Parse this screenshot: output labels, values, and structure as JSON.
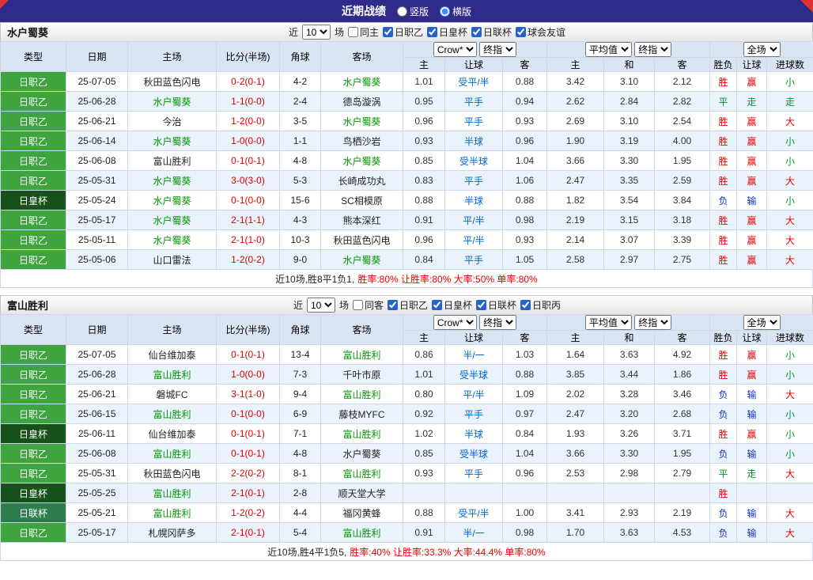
{
  "topbar": {
    "title": "近期战绩",
    "options": [
      {
        "label": "竖版",
        "selected": false
      },
      {
        "label": "横版",
        "selected": true
      }
    ]
  },
  "filter_labels": {
    "near": "近",
    "games": "场"
  },
  "columns": {
    "type": "类型",
    "date": "日期",
    "home": "主场",
    "score": "比分(半场)",
    "corner": "角球",
    "away": "客场",
    "crow": "Crow*",
    "final": "终指",
    "average": "平均值",
    "full": "全场",
    "sub": [
      "主",
      "让球",
      "客",
      "主",
      "和",
      "客",
      "胜负",
      "让球",
      "进球数"
    ]
  },
  "colors": {
    "topbar": "#2e2b8b",
    "league_j2": "#3fa33f",
    "league_emperor_cup": "#17521a",
    "league_league_cup": "#2e7d4f",
    "win": "#e60000",
    "draw": "#009933",
    "lose": "#1133cc",
    "score_text": "#e00000",
    "focus_team": "#009900",
    "handicap_text": "#0066cc"
  },
  "sections": [
    {
      "team": "水户蜀葵",
      "filter": {
        "count": "10",
        "same": "同主",
        "same_checked": false,
        "leagues": [
          {
            "label": "日职乙",
            "checked": true
          },
          {
            "label": "日皇杯",
            "checked": true
          },
          {
            "label": "日联杯",
            "checked": true
          },
          {
            "label": "球会友谊",
            "checked": true
          }
        ]
      },
      "rows": [
        {
          "league": "日职乙",
          "lc": "j2",
          "date": "25-07-05",
          "home": "秋田蓝色闪电",
          "hf": false,
          "score": "0-2(0-1)",
          "corner": "4-2",
          "away": "水户蜀葵",
          "af": true,
          "h": "1.01",
          "hcp": "受平/半",
          "a": "0.88",
          "m1": "3.42",
          "m2": "3.10",
          "m3": "2.12",
          "r": "胜",
          "c": "赢",
          "g": "小"
        },
        {
          "league": "日职乙",
          "lc": "j2",
          "date": "25-06-28",
          "home": "水户蜀葵",
          "hf": true,
          "score": "1-1(0-0)",
          "corner": "2-4",
          "away": "德岛漩涡",
          "af": false,
          "h": "0.95",
          "hcp": "平手",
          "a": "0.94",
          "m1": "2.62",
          "m2": "2.84",
          "m3": "2.82",
          "r": "平",
          "c": "走",
          "g": "走"
        },
        {
          "league": "日职乙",
          "lc": "j2",
          "date": "25-06-21",
          "home": "今治",
          "hf": false,
          "score": "1-2(0-0)",
          "corner": "3-5",
          "away": "水户蜀葵",
          "af": true,
          "h": "0.96",
          "hcp": "平手",
          "a": "0.93",
          "m1": "2.69",
          "m2": "3.10",
          "m3": "2.54",
          "r": "胜",
          "c": "赢",
          "g": "大"
        },
        {
          "league": "日职乙",
          "lc": "j2",
          "date": "25-06-14",
          "home": "水户蜀葵",
          "hf": true,
          "score": "1-0(0-0)",
          "corner": "1-1",
          "away": "鸟栖沙岩",
          "af": false,
          "h": "0.93",
          "hcp": "半球",
          "a": "0.96",
          "m1": "1.90",
          "m2": "3.19",
          "m3": "4.00",
          "r": "胜",
          "c": "赢",
          "g": "小"
        },
        {
          "league": "日职乙",
          "lc": "j2",
          "date": "25-06-08",
          "home": "富山胜利",
          "hf": false,
          "score": "0-1(0-1)",
          "corner": "4-8",
          "away": "水户蜀葵",
          "af": true,
          "h": "0.85",
          "hcp": "受半球",
          "a": "1.04",
          "m1": "3.66",
          "m2": "3.30",
          "m3": "1.95",
          "r": "胜",
          "c": "赢",
          "g": "小"
        },
        {
          "league": "日职乙",
          "lc": "j2",
          "date": "25-05-31",
          "home": "水户蜀葵",
          "hf": true,
          "score": "3-0(3-0)",
          "corner": "5-3",
          "away": "长崎成功丸",
          "af": false,
          "h": "0.83",
          "hcp": "平手",
          "a": "1.06",
          "m1": "2.47",
          "m2": "3.35",
          "m3": "2.59",
          "r": "胜",
          "c": "赢",
          "g": "大"
        },
        {
          "league": "日皇杯",
          "lc": "cup",
          "date": "25-05-24",
          "home": "水户蜀葵",
          "hf": true,
          "score": "0-1(0-0)",
          "corner": "15-6",
          "away": "SC相模原",
          "af": false,
          "h": "0.88",
          "hcp": "半球",
          "a": "0.88",
          "m1": "1.82",
          "m2": "3.54",
          "m3": "3.84",
          "r": "负",
          "c": "输",
          "g": "小"
        },
        {
          "league": "日职乙",
          "lc": "j2",
          "date": "25-05-17",
          "home": "水户蜀葵",
          "hf": true,
          "score": "2-1(1-1)",
          "corner": "4-3",
          "away": "熊本深红",
          "af": false,
          "h": "0.91",
          "hcp": "平/半",
          "a": "0.98",
          "m1": "2.19",
          "m2": "3.15",
          "m3": "3.18",
          "r": "胜",
          "c": "赢",
          "g": "大"
        },
        {
          "league": "日职乙",
          "lc": "j2",
          "date": "25-05-11",
          "home": "水户蜀葵",
          "hf": true,
          "score": "2-1(1-0)",
          "corner": "10-3",
          "away": "秋田蓝色闪电",
          "af": false,
          "h": "0.96",
          "hcp": "平/半",
          "a": "0.93",
          "m1": "2.14",
          "m2": "3.07",
          "m3": "3.39",
          "r": "胜",
          "c": "赢",
          "g": "大"
        },
        {
          "league": "日职乙",
          "lc": "j2",
          "date": "25-05-06",
          "home": "山口雷法",
          "hf": false,
          "score": "1-2(0-2)",
          "corner": "9-0",
          "away": "水户蜀葵",
          "af": true,
          "h": "0.84",
          "hcp": "平手",
          "a": "1.05",
          "m1": "2.58",
          "m2": "2.97",
          "m3": "2.75",
          "r": "胜",
          "c": "赢",
          "g": "大"
        }
      ],
      "footer": {
        "prefix": "近10场,胜8平1负1,",
        "stats": "胜率:80% 让胜率:80% 大率:50% 单率:80%"
      }
    },
    {
      "team": "富山胜利",
      "filter": {
        "count": "10",
        "same": "同客",
        "same_checked": false,
        "leagues": [
          {
            "label": "日职乙",
            "checked": true
          },
          {
            "label": "日皇杯",
            "checked": true
          },
          {
            "label": "日联杯",
            "checked": true
          },
          {
            "label": "日职丙",
            "checked": true
          }
        ]
      },
      "rows": [
        {
          "league": "日职乙",
          "lc": "j2",
          "date": "25-07-05",
          "home": "仙台维加泰",
          "hf": false,
          "score": "0-1(0-1)",
          "corner": "13-4",
          "away": "富山胜利",
          "af": true,
          "h": "0.86",
          "hcp": "半/一",
          "a": "1.03",
          "m1": "1.64",
          "m2": "3.63",
          "m3": "4.92",
          "r": "胜",
          "c": "赢",
          "g": "小"
        },
        {
          "league": "日职乙",
          "lc": "j2",
          "date": "25-06-28",
          "home": "富山胜利",
          "hf": true,
          "score": "1-0(0-0)",
          "corner": "7-3",
          "away": "千叶市原",
          "af": false,
          "h": "1.01",
          "hcp": "受半球",
          "a": "0.88",
          "m1": "3.85",
          "m2": "3.44",
          "m3": "1.86",
          "r": "胜",
          "c": "赢",
          "g": "小"
        },
        {
          "league": "日职乙",
          "lc": "j2",
          "date": "25-06-21",
          "home": "磐城FC",
          "hf": false,
          "score": "3-1(1-0)",
          "corner": "9-4",
          "away": "富山胜利",
          "af": true,
          "h": "0.80",
          "hcp": "平/半",
          "a": "1.09",
          "m1": "2.02",
          "m2": "3.28",
          "m3": "3.46",
          "r": "负",
          "c": "输",
          "g": "大"
        },
        {
          "league": "日职乙",
          "lc": "j2",
          "date": "25-06-15",
          "home": "富山胜利",
          "hf": true,
          "score": "0-1(0-0)",
          "corner": "6-9",
          "away": "藤枝MYFC",
          "af": false,
          "h": "0.92",
          "hcp": "平手",
          "a": "0.97",
          "m1": "2.47",
          "m2": "3.20",
          "m3": "2.68",
          "r": "负",
          "c": "输",
          "g": "小"
        },
        {
          "league": "日皇杯",
          "lc": "cup",
          "date": "25-06-11",
          "home": "仙台维加泰",
          "hf": false,
          "score": "0-1(0-1)",
          "corner": "7-1",
          "away": "富山胜利",
          "af": true,
          "h": "1.02",
          "hcp": "半球",
          "a": "0.84",
          "m1": "1.93",
          "m2": "3.26",
          "m3": "3.71",
          "r": "胜",
          "c": "赢",
          "g": "小"
        },
        {
          "league": "日职乙",
          "lc": "j2",
          "date": "25-06-08",
          "home": "富山胜利",
          "hf": true,
          "score": "0-1(0-1)",
          "corner": "4-8",
          "away": "水户蜀葵",
          "af": false,
          "h": "0.85",
          "hcp": "受半球",
          "a": "1.04",
          "m1": "3.66",
          "m2": "3.30",
          "m3": "1.95",
          "r": "负",
          "c": "输",
          "g": "小"
        },
        {
          "league": "日职乙",
          "lc": "j2",
          "date": "25-05-31",
          "home": "秋田蓝色闪电",
          "hf": false,
          "score": "2-2(0-2)",
          "corner": "8-1",
          "away": "富山胜利",
          "af": true,
          "h": "0.93",
          "hcp": "平手",
          "a": "0.96",
          "m1": "2.53",
          "m2": "2.98",
          "m3": "2.79",
          "r": "平",
          "c": "走",
          "g": "大"
        },
        {
          "league": "日皇杯",
          "lc": "cup",
          "date": "25-05-25",
          "home": "富山胜利",
          "hf": true,
          "score": "2-1(0-1)",
          "corner": "2-8",
          "away": "顺天堂大学",
          "af": false,
          "h": "",
          "hcp": "",
          "a": "",
          "m1": "",
          "m2": "",
          "m3": "",
          "r": "胜",
          "c": "",
          "g": ""
        },
        {
          "league": "日联杯",
          "lc": "lcup",
          "date": "25-05-21",
          "home": "富山胜利",
          "hf": true,
          "score": "1-2(0-2)",
          "corner": "4-4",
          "away": "福冈黄蜂",
          "af": false,
          "h": "0.88",
          "hcp": "受平/半",
          "a": "1.00",
          "m1": "3.41",
          "m2": "2.93",
          "m3": "2.19",
          "r": "负",
          "c": "输",
          "g": "大"
        },
        {
          "league": "日职乙",
          "lc": "j2",
          "date": "25-05-17",
          "home": "札幌冈萨多",
          "hf": false,
          "score": "2-1(0-1)",
          "corner": "5-4",
          "away": "富山胜利",
          "af": true,
          "h": "0.91",
          "hcp": "半/一",
          "a": "0.98",
          "m1": "1.70",
          "m2": "3.63",
          "m3": "4.53",
          "r": "负",
          "c": "输",
          "g": "大"
        }
      ],
      "footer": {
        "prefix": "近10场,胜4平1负5,",
        "stats": "胜率:40% 让胜率:33.3% 大率:44.4% 单率:80%"
      }
    }
  ]
}
